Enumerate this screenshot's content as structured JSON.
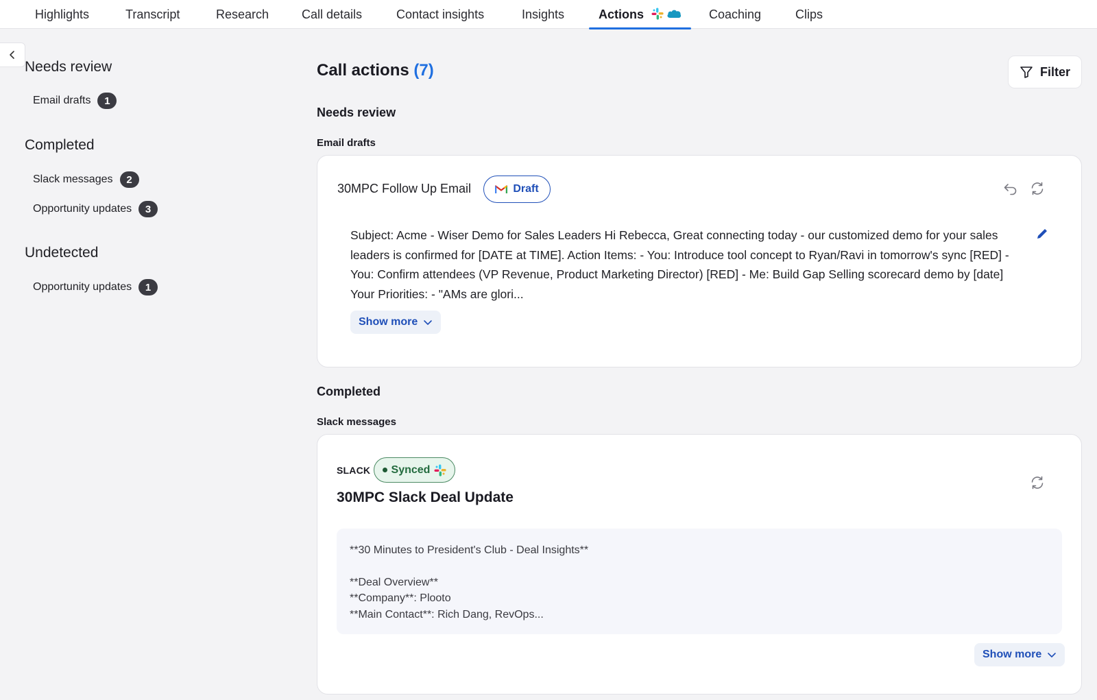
{
  "tabs": [
    {
      "label": "Highlights"
    },
    {
      "label": "Transcript"
    },
    {
      "label": "Research"
    },
    {
      "label": "Call details"
    },
    {
      "label": "Contact insights"
    },
    {
      "label": "Insights"
    },
    {
      "label": "Actions",
      "active": true
    },
    {
      "label": "Coaching"
    },
    {
      "label": "Clips"
    }
  ],
  "sidebar": {
    "collapse_icon": "chevron-left-icon",
    "groups": [
      {
        "heading": "Needs review",
        "items": [
          {
            "label": "Email drafts",
            "count": "1"
          }
        ]
      },
      {
        "heading": "Completed",
        "items": [
          {
            "label": "Slack messages",
            "count": "2"
          },
          {
            "label": "Opportunity updates",
            "count": "3"
          }
        ]
      },
      {
        "heading": "Undetected",
        "items": [
          {
            "label": "Opportunity updates",
            "count": "1"
          }
        ]
      }
    ]
  },
  "main": {
    "title": "Call actions",
    "count": "(7)",
    "filter_label": "Filter",
    "needs_review": {
      "heading": "Needs review",
      "group": "Email drafts",
      "email": {
        "title": "30MPC Follow Up Email",
        "status": "Draft",
        "body": "Subject: Acme - Wiser Demo for Sales Leaders Hi Rebecca, Great connecting today - our customized demo for your sales leaders is confirmed for [DATE at TIME]. Action Items: - You: Introduce tool concept to Ryan/Ravi in tomorrow's sync [RED] - You: Confirm attendees (VP Revenue, Product Marketing Director) [RED] - Me: Build Gap Selling scorecard demo by [date] Your Priorities: - \"AMs are glori...",
        "show_more": "Show more"
      }
    },
    "completed": {
      "heading": "Completed",
      "group": "Slack messages",
      "slack": {
        "source": "SLACK",
        "status": "Synced",
        "title": "30MPC Slack Deal Update",
        "lines": [
          "**30 Minutes to President's Club - Deal Insights**",
          "",
          "**Deal Overview**",
          "**Company**: Plooto",
          "**Main Contact**: Rich Dang, RevOps..."
        ],
        "show_more": "Show more"
      }
    }
  },
  "colors": {
    "accent": "#1f6fe0",
    "link": "#1f4fb8",
    "synced_bg": "#e7f5ec",
    "synced_text": "#236b3e",
    "badge": "#3b3b42",
    "page_bg": "#f3f3f5"
  }
}
